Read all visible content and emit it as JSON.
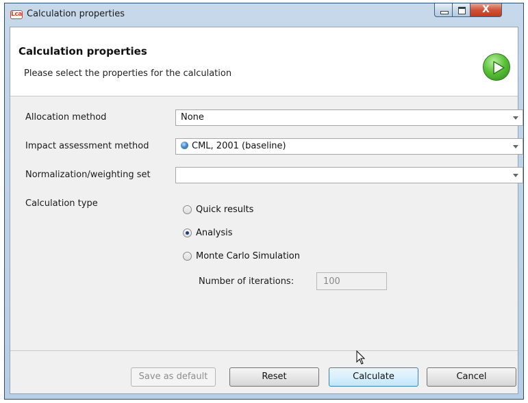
{
  "window": {
    "title": "Calculation properties",
    "app_icon_text": "Lca",
    "close_glyph": "X"
  },
  "header": {
    "title": "Calculation properties",
    "subtitle": "Please select the properties for the calculation",
    "icon": "play-icon"
  },
  "form": {
    "allocation": {
      "label": "Allocation method",
      "value": "None"
    },
    "impact": {
      "label": "Impact assessment method",
      "value": "CML, 2001 (baseline)"
    },
    "normalization": {
      "label": "Normalization/weighting set",
      "value": ""
    },
    "calc_type": {
      "label": "Calculation type",
      "options": [
        "Quick results",
        "Analysis",
        "Monte Carlo Simulation"
      ],
      "selected": "Analysis"
    },
    "iterations": {
      "label": "Number of iterations:",
      "value": "100"
    }
  },
  "buttons": {
    "save_default": "Save as default",
    "reset": "Reset",
    "calculate": "Calculate",
    "cancel": "Cancel"
  },
  "colors": {
    "accent": "#3c7fb1",
    "play_icon": "#5cc23a",
    "close_button": "#c3391d"
  }
}
